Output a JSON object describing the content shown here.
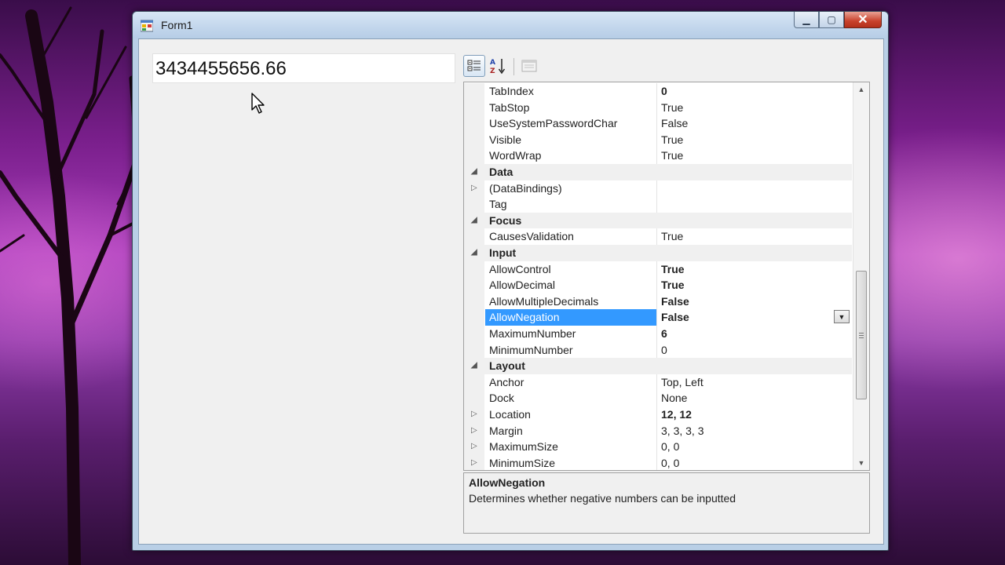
{
  "window": {
    "title": "Form1"
  },
  "numeric_box": {
    "value": "3434455656.66"
  },
  "toolbar": {
    "categorized_icon": "categorized-icon",
    "alphabetical_icon": "alphabetical-icon",
    "property_pages_icon": "property-pages-icon"
  },
  "grid": {
    "rows": [
      {
        "kind": "prop",
        "name": "TabIndex",
        "value": "0",
        "bold": true
      },
      {
        "kind": "prop",
        "name": "TabStop",
        "value": "True"
      },
      {
        "kind": "prop",
        "name": "UseSystemPasswordChar",
        "value": "False"
      },
      {
        "kind": "prop",
        "name": "Visible",
        "value": "True"
      },
      {
        "kind": "prop",
        "name": "WordWrap",
        "value": "True"
      },
      {
        "kind": "cat",
        "name": "Data"
      },
      {
        "kind": "prop",
        "name": "(DataBindings)",
        "value": "",
        "expand": true
      },
      {
        "kind": "prop",
        "name": "Tag",
        "value": ""
      },
      {
        "kind": "cat",
        "name": "Focus"
      },
      {
        "kind": "prop",
        "name": "CausesValidation",
        "value": "True"
      },
      {
        "kind": "cat",
        "name": "Input"
      },
      {
        "kind": "prop",
        "name": "AllowControl",
        "value": "True",
        "bold": true
      },
      {
        "kind": "prop",
        "name": "AllowDecimal",
        "value": "True",
        "bold": true
      },
      {
        "kind": "prop",
        "name": "AllowMultipleDecimals",
        "value": "False",
        "bold": true
      },
      {
        "kind": "prop",
        "name": "AllowNegation",
        "value": "False",
        "bold": true,
        "selected": true
      },
      {
        "kind": "prop",
        "name": "MaximumNumber",
        "value": "6",
        "bold": true
      },
      {
        "kind": "prop",
        "name": "MinimumNumber",
        "value": "0"
      },
      {
        "kind": "cat",
        "name": "Layout"
      },
      {
        "kind": "prop",
        "name": "Anchor",
        "value": "Top, Left"
      },
      {
        "kind": "prop",
        "name": "Dock",
        "value": "None"
      },
      {
        "kind": "prop",
        "name": "Location",
        "value": "12, 12",
        "bold": true,
        "expand": true
      },
      {
        "kind": "prop",
        "name": "Margin",
        "value": "3, 3, 3, 3",
        "expand": true
      },
      {
        "kind": "prop",
        "name": "MaximumSize",
        "value": "0, 0",
        "expand": true
      },
      {
        "kind": "prop",
        "name": "MinimumSize",
        "value": "0, 0",
        "expand": true
      }
    ]
  },
  "help": {
    "title": "AllowNegation",
    "description": "Determines whether negative numbers can be inputted"
  }
}
